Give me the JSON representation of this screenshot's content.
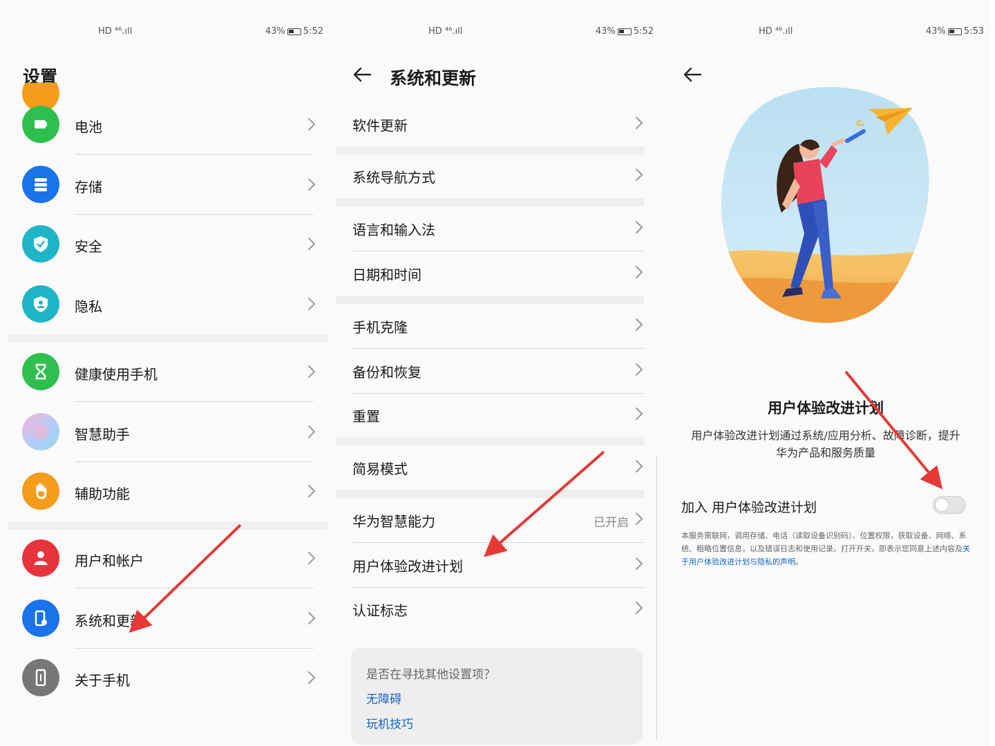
{
  "status_bars": [
    {
      "left": "HD ⁴⁶.ıll",
      "right": "43%",
      "time": "5:52"
    },
    {
      "left": "HD ⁴⁶.ıll",
      "right": "43%",
      "time": "5:52"
    },
    {
      "left": "HD ⁴⁶.ıll",
      "right": "43%",
      "time": "5:53"
    }
  ],
  "settings": {
    "title": "设置",
    "items": [
      {
        "label": "电池",
        "icon": "battery-icon",
        "color": "#2fbf4f"
      },
      {
        "label": "存储",
        "icon": "storage-icon",
        "color": "#1a73e8"
      },
      {
        "label": "安全",
        "icon": "shield-icon",
        "color": "#1eb5c8"
      },
      {
        "label": "隐私",
        "icon": "privacy-icon",
        "color": "#1eb5c8"
      },
      {
        "label": "健康使用手机",
        "icon": "hourglass-icon",
        "color": "#2fbf4f"
      },
      {
        "label": "智慧助手",
        "icon": "assistant-icon",
        "color": "#b8a0f0"
      },
      {
        "label": "辅助功能",
        "icon": "hand-icon",
        "color": "#f59c1a"
      },
      {
        "label": "用户和帐户",
        "icon": "user-icon",
        "color": "#e8333a"
      },
      {
        "label": "系统和更新",
        "icon": "system-update-icon",
        "color": "#1a73e8"
      },
      {
        "label": "关于手机",
        "icon": "phone-icon",
        "color": "#777777"
      }
    ]
  },
  "system_update": {
    "title": "系统和更新",
    "items": [
      {
        "label": "软件更新",
        "value": ""
      },
      {
        "label": "系统导航方式",
        "value": ""
      },
      {
        "label": "语言和输入法",
        "value": ""
      },
      {
        "label": "日期和时间",
        "value": ""
      },
      {
        "label": "手机克隆",
        "value": ""
      },
      {
        "label": "备份和恢复",
        "value": ""
      },
      {
        "label": "重置",
        "value": ""
      },
      {
        "label": "简易模式",
        "value": ""
      },
      {
        "label": "华为智慧能力",
        "value": "已开启"
      },
      {
        "label": "用户体验改进计划",
        "value": ""
      },
      {
        "label": "认证标志",
        "value": ""
      }
    ],
    "search_prompt": "是否在寻找其他设置项？",
    "links": [
      "无障碍",
      "玩机技巧"
    ]
  },
  "ux_plan": {
    "heading": "用户体验改进计划",
    "description": "用户体验改进计划通过系统/应用分析、故障诊断，提升华为产品和服务质量",
    "join_label": "加入 用户体验改进计划",
    "toggle_on": false,
    "fine_print": "本服务需联网，调用存储、电话（读取设备识别码）、位置权限，获取设备、网络、系统、粗略位置信息，以及错误日志和使用记录。打开开关，即表示您同意上述内容及",
    "fine_link": "关于用户体验改进计划与隐私的声明",
    "fine_end": "。"
  },
  "colors": {
    "annotation_arrow": "#e53935",
    "link": "#1565c0"
  }
}
